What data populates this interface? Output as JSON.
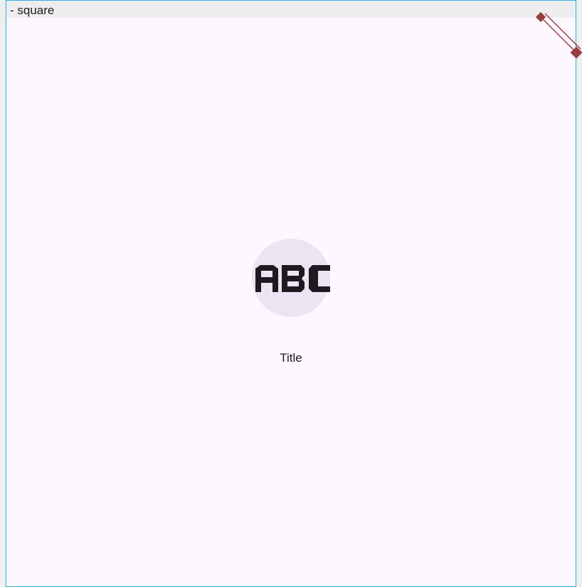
{
  "preview": {
    "label": "- square",
    "title": "Title"
  },
  "icons": {
    "leading": "abc-icon",
    "corner_badge": "debug-banner-icon"
  },
  "colors": {
    "frame_border": "#2eaee0",
    "surface": "#fdf7ff",
    "header_bg": "#eeeeef",
    "icon_container": "#ebe4f3",
    "on_surface": "#1d1b20",
    "badge": "#9a3d43"
  }
}
